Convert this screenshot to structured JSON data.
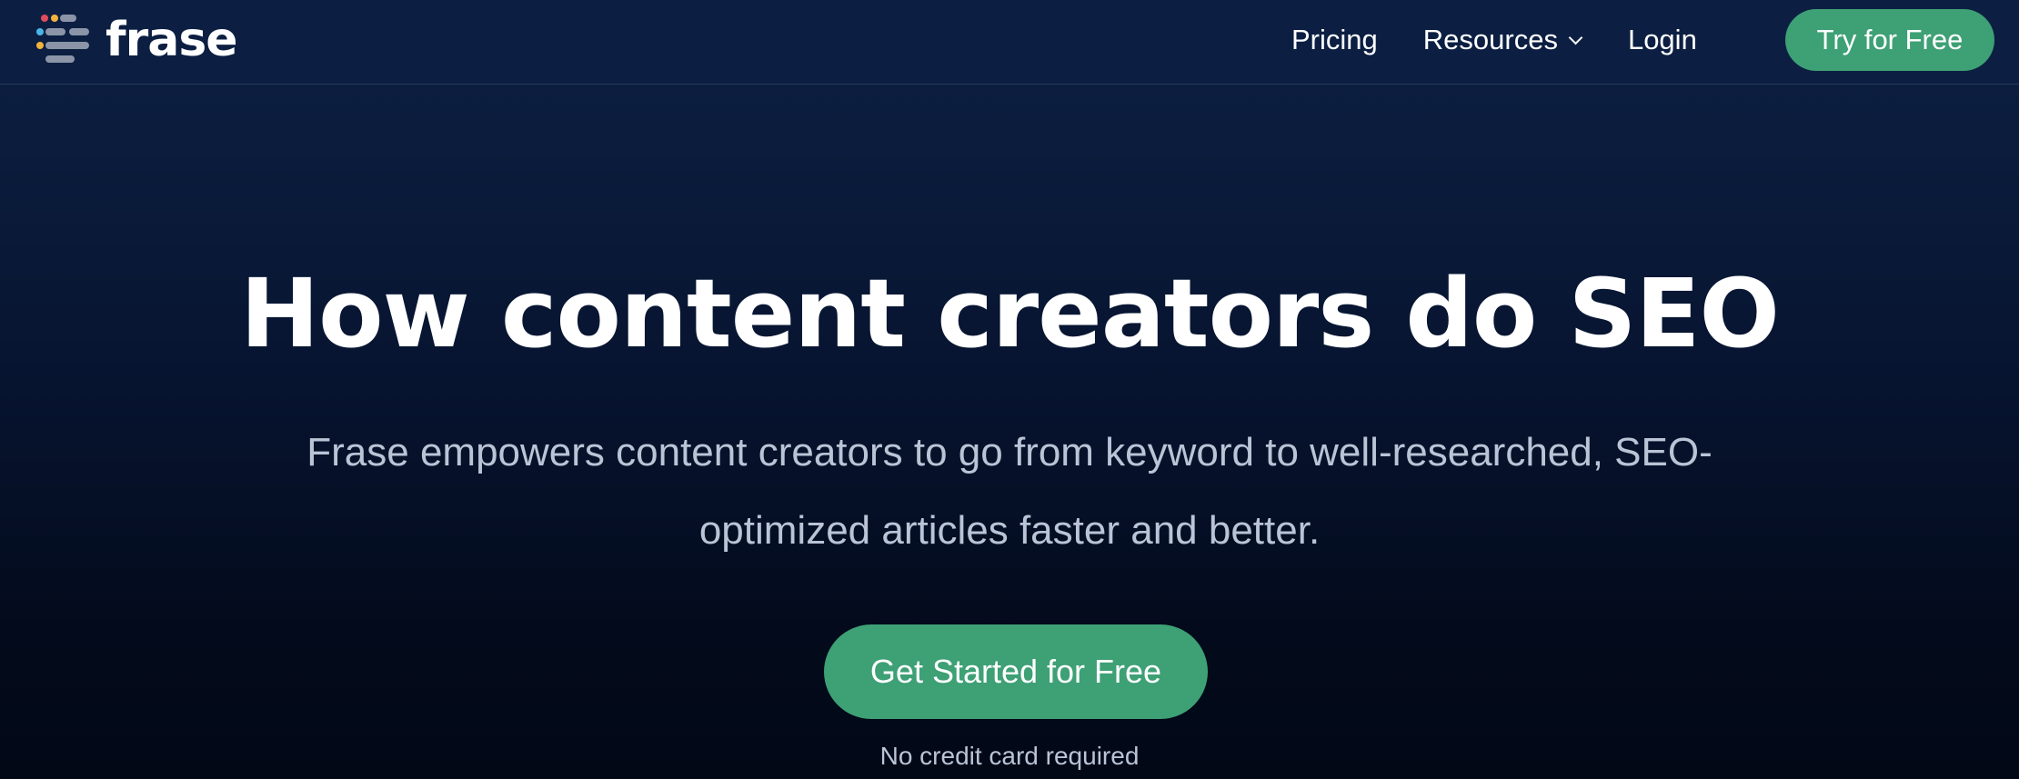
{
  "brand": {
    "name": "frase",
    "logo_icon": "frase-logo-icon",
    "logo_colors": [
      "#e24b5b",
      "#f2b33d",
      "#4ab6e8",
      "#8b95a7"
    ]
  },
  "nav": {
    "pricing": "Pricing",
    "resources": "Resources",
    "login": "Login",
    "cta": "Try for Free"
  },
  "hero": {
    "title": "How content creators do SEO",
    "subtitle": "Frase empowers content creators to go from keyword to well-researched, SEO-optimized articles faster and better.",
    "cta": "Get Started for Free",
    "note": "No credit card required"
  },
  "colors": {
    "accent": "#3ea075",
    "background_top": "#0c1f42",
    "background_bottom": "#020816",
    "muted_text": "#b9c4d6"
  }
}
